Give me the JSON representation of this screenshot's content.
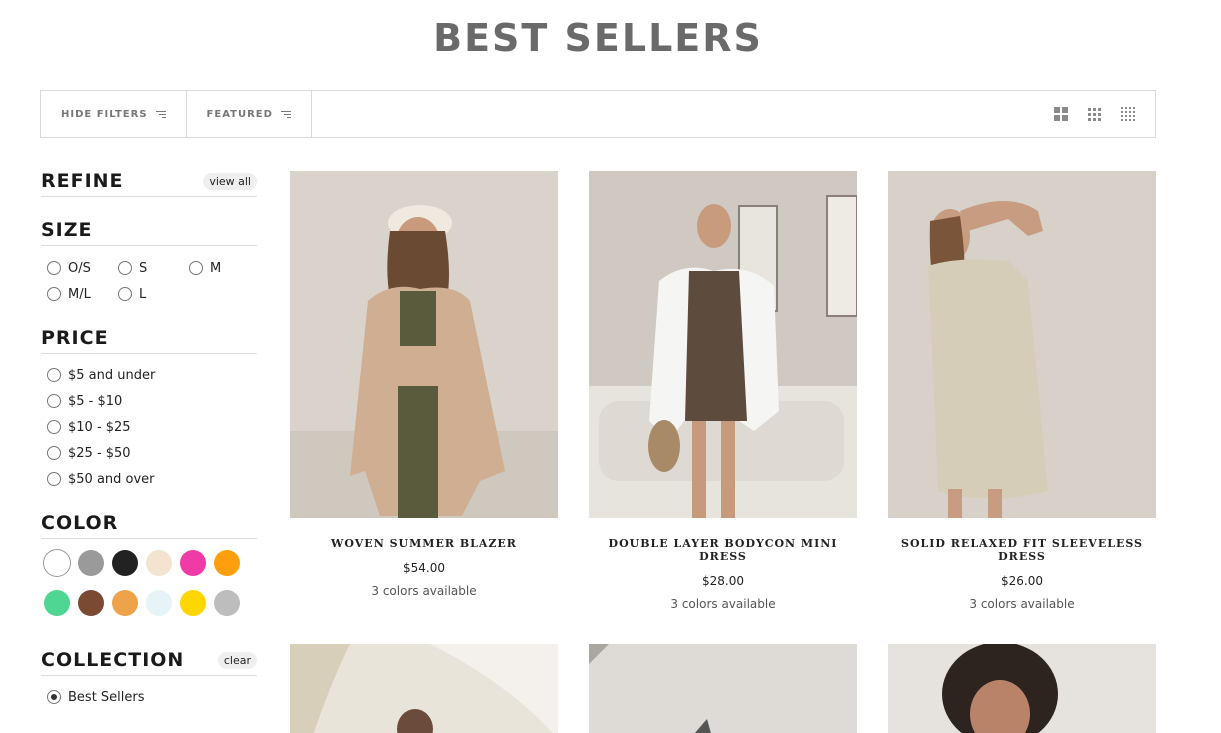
{
  "page": {
    "title": "BEST SELLERS"
  },
  "toolbar": {
    "hide_filters": "HIDE FILTERS",
    "sort": "FEATURED"
  },
  "refine": {
    "title": "REFINE",
    "view_all": "view all"
  },
  "size": {
    "title": "SIZE",
    "options": [
      "O/S",
      "S",
      "M",
      "M/L",
      "L"
    ]
  },
  "price": {
    "title": "PRICE",
    "options": [
      "$5 and under",
      "$5 - $10",
      "$10 - $25",
      "$25 - $50",
      "$50 and over"
    ]
  },
  "color": {
    "title": "COLOR",
    "swatches": [
      "#ffffff",
      "#9a9a9a",
      "#222222",
      "#f2e4cf",
      "#f03aa6",
      "#ff9f0e",
      "#4fd693",
      "#7a4a32",
      "#eea24a",
      "#e6f4f8",
      "#ffd600",
      "#bdbdbd"
    ]
  },
  "collection": {
    "title": "COLLECTION",
    "clear": "clear",
    "selected": "Best Sellers"
  },
  "products": [
    {
      "name": "WOVEN SUMMER BLAZER",
      "price": "$54.00",
      "colors": "3 colors available"
    },
    {
      "name": "DOUBLE LAYER BODYCON MINI DRESS",
      "price": "$28.00",
      "colors": "3 colors available"
    },
    {
      "name": "SOLID RELAXED FIT SLEEVELESS DRESS",
      "price": "$26.00",
      "colors": "3 colors available"
    }
  ]
}
